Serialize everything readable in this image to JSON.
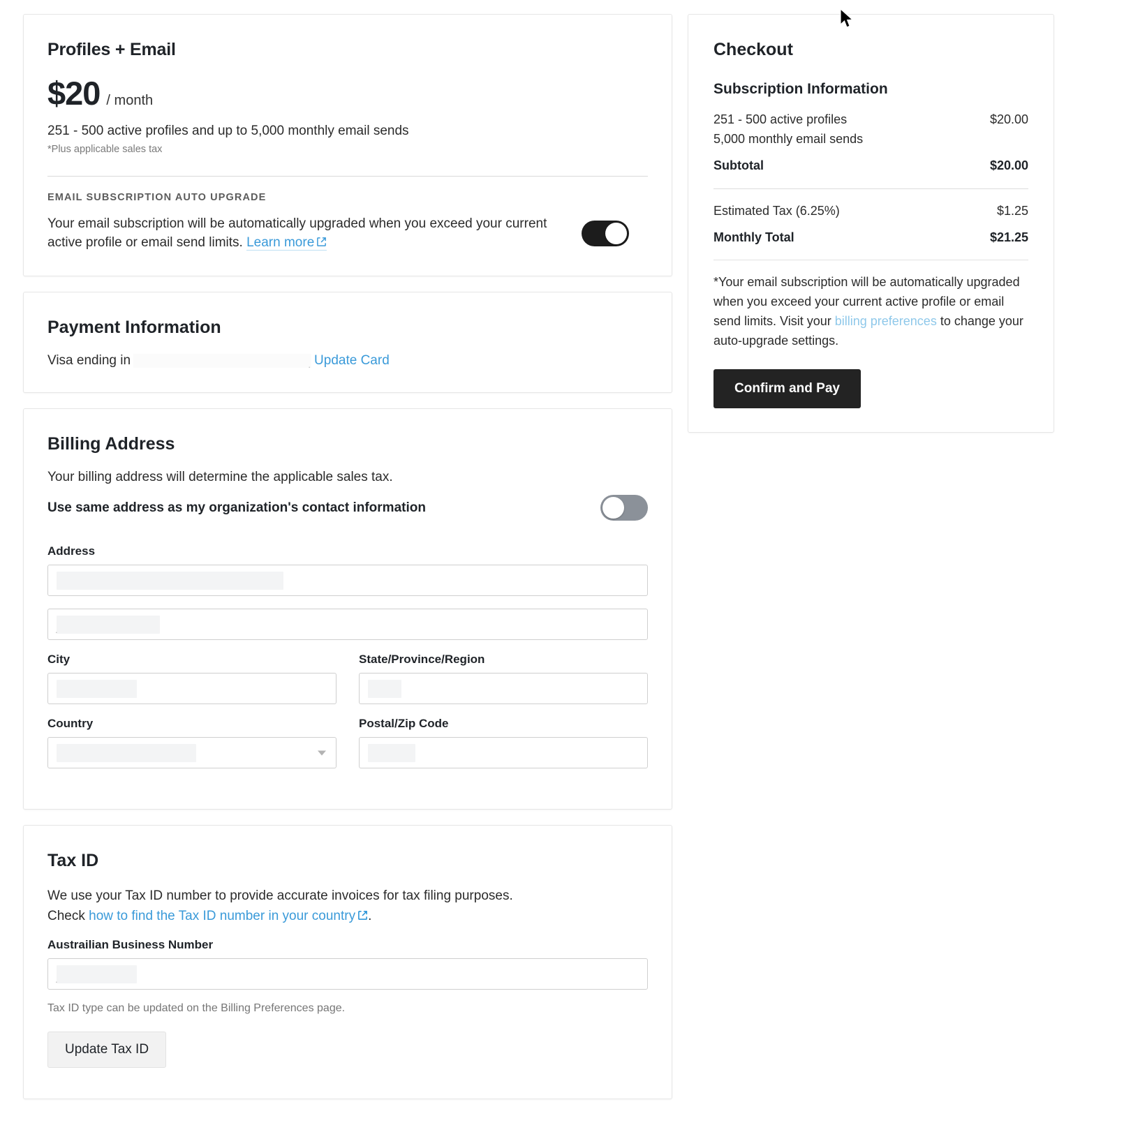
{
  "plan": {
    "title": "Profiles + Email",
    "price_amount": "$20",
    "price_period": "/ month",
    "description": "251 - 500 active profiles and up to 5,000 monthly email sends",
    "tax_note": "*Plus applicable sales tax",
    "auto_upgrade_heading": "EMAIL SUBSCRIPTION AUTO UPGRADE",
    "auto_upgrade_text": "Your email subscription will be automatically upgraded when you exceed your current active profile or email send limits.",
    "learn_more_label": "Learn more",
    "toggle_state": "on"
  },
  "payment": {
    "title": "Payment Information",
    "card_label": "Visa ending in",
    "card_value_masked": "",
    "update_card_label": "Update Card"
  },
  "billing": {
    "title": "Billing Address",
    "subtitle": "Your billing address will determine the applicable sales tax.",
    "same_address_label": "Use same address as my organization's contact information",
    "same_address_toggle_state": "off",
    "address_label": "Address",
    "address_line1_value": "",
    "address_line2_value": "",
    "city_label": "City",
    "city_value": "",
    "state_label": "State/Province/Region",
    "state_value": "",
    "country_label": "Country",
    "country_value": "",
    "postal_label": "Postal/Zip Code",
    "postal_value": ""
  },
  "tax_id": {
    "title": "Tax ID",
    "description_line1": "We use your Tax ID number to provide accurate invoices for tax filing purposes.",
    "description_check_prefix": "Check ",
    "description_link": "how to find the Tax ID number in your country",
    "description_suffix": ".",
    "field_label": "Austrailian Business Number",
    "field_value": "",
    "hint": "Tax ID type can be updated on the Billing Preferences page.",
    "update_button_label": "Update Tax ID"
  },
  "checkout": {
    "title": "Checkout",
    "section_title": "Subscription Information",
    "items": [
      {
        "label_line1": "251 - 500 active profiles",
        "label_line2": "5,000 monthly email sends",
        "value": "$20.00"
      }
    ],
    "subtotal_label": "Subtotal",
    "subtotal_value": "$20.00",
    "tax_label": "Estimated Tax (6.25%)",
    "tax_value": "$1.25",
    "total_label": "Monthly Total",
    "total_value": "$21.25",
    "note_part1": "*Your email subscription will be automatically upgraded when you exceed your current active profile or email send limits. Visit your ",
    "note_link": "billing preferences",
    "note_part2": " to change your auto-upgrade settings.",
    "confirm_button_label": "Confirm and Pay"
  },
  "colors": {
    "link": "#3a9ad9",
    "link_light": "#8ec8ea",
    "toggle_on": "#1c1c1c",
    "toggle_off": "#8b9199",
    "primary_button": "#232323",
    "text": "#1f2328"
  }
}
